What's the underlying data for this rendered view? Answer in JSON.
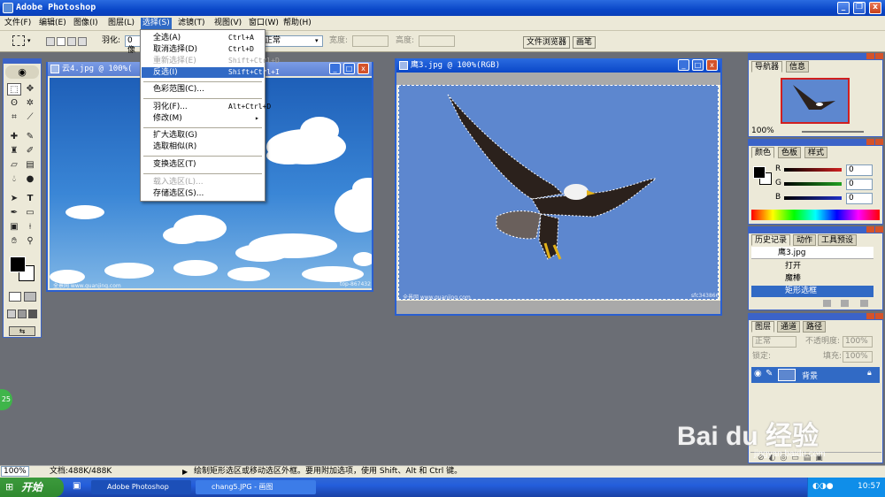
{
  "app": {
    "title": "Adobe Photoshop"
  },
  "window_buttons": {
    "minimize": "_",
    "restore": "❐",
    "close": "x"
  },
  "menubar": {
    "items": [
      "文件(F)",
      "编辑(E)",
      "图像(I)",
      "图层(L)",
      "选择(S)",
      "滤镜(T)",
      "视图(V)",
      "窗口(W)",
      "帮助(H)"
    ],
    "active": "选择(S)"
  },
  "options": {
    "feather_label": "羽化:",
    "feather_value": "0 像",
    "style_value": "正常",
    "width_label": "宽度:",
    "height_label": "高度:",
    "palette_wells": [
      "文件浏览器",
      "画笔"
    ]
  },
  "select_menu": {
    "items": [
      {
        "label": "全选(A)",
        "shortcut": "Ctrl+A",
        "enabled": true
      },
      {
        "label": "取消选择(D)",
        "shortcut": "Ctrl+D",
        "enabled": true
      },
      {
        "label": "重新选择(E)",
        "shortcut": "Shift+Ctrl+D",
        "enabled": false
      },
      {
        "label": "反选(I)",
        "shortcut": "Shift+Ctrl+I",
        "enabled": true,
        "highlighted": true
      },
      {
        "label": "色彩范围(C)...",
        "shortcut": "",
        "enabled": true
      },
      {
        "label": "羽化(F)...",
        "shortcut": "Alt+Ctrl+D",
        "enabled": true
      },
      {
        "label": "修改(M)",
        "shortcut": "▸",
        "enabled": true
      },
      {
        "label": "扩大选取(G)",
        "shortcut": "",
        "enabled": true
      },
      {
        "label": "选取相似(R)",
        "shortcut": "",
        "enabled": true
      },
      {
        "label": "变换选区(T)",
        "shortcut": "",
        "enabled": true
      },
      {
        "label": "载入选区(L)...",
        "shortcut": "",
        "enabled": false
      },
      {
        "label": "存储选区(S)...",
        "shortcut": "",
        "enabled": true
      }
    ]
  },
  "documents": {
    "clouds": {
      "title": "云4.jpg @ 100%(",
      "watermark": "全景网 www.quanjing.com",
      "code": "top-867432"
    },
    "eagle": {
      "title": "鹰3.jpg @ 100%(RGB)",
      "watermark": "全景网 www.quanjing.com",
      "code": "sfc343866"
    }
  },
  "navigator": {
    "tabs": [
      "导航器",
      "信息"
    ],
    "zoom": "100%"
  },
  "color": {
    "tabs": [
      "颜色",
      "色板",
      "样式"
    ],
    "channels": [
      {
        "name": "R",
        "value": "0",
        "color": "#d02020"
      },
      {
        "name": "G",
        "value": "0",
        "color": "#20a020"
      },
      {
        "name": "B",
        "value": "0",
        "color": "#2030c8"
      }
    ]
  },
  "history": {
    "tabs": [
      "历史记录",
      "动作",
      "工具预设"
    ],
    "snapshot": "鹰3.jpg",
    "steps": [
      {
        "label": "打开",
        "active": false
      },
      {
        "label": "魔棒",
        "active": false
      },
      {
        "label": "矩形选框",
        "active": true
      }
    ]
  },
  "layers": {
    "tabs": [
      "图层",
      "通道",
      "路径"
    ],
    "blend_mode": "正常",
    "opacity_label": "不透明度:",
    "opacity_value": "100%",
    "lock_label": "锁定:",
    "fill_label": "填充:",
    "fill_value": "100%",
    "items": [
      {
        "name": "背景",
        "visible": true
      }
    ]
  },
  "statusbar": {
    "zoom": "100%",
    "doc_size": "文档:488K/488K",
    "hint": "绘制矩形选区或移动选区外框。要用附加选项，使用 Shift、Alt 和 Ctrl 键。"
  },
  "taskbar": {
    "start": "开始",
    "tasks": [
      "Adobe Photoshop",
      "chang5.JPG - 画图"
    ],
    "clock": "10:57"
  },
  "baidu": {
    "brand": "Bai du 经验",
    "url": "jingyan.baidu.com"
  },
  "side_badge": "25"
}
